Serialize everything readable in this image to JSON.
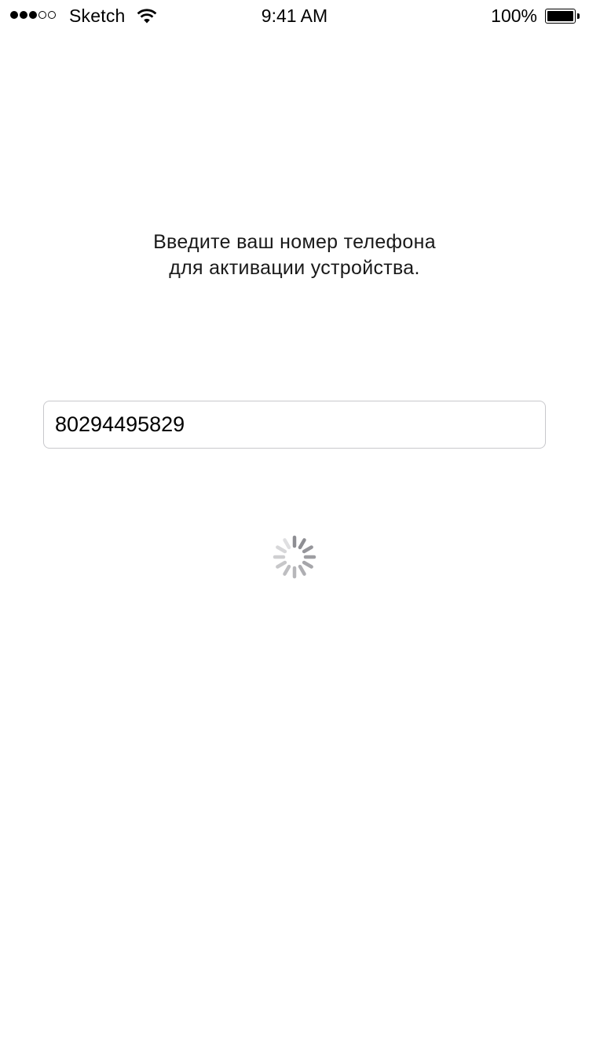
{
  "status_bar": {
    "signal_bars_filled": 3,
    "signal_bars_total": 5,
    "carrier": "Sketch",
    "time": "9:41 AM",
    "battery_percent": "100%",
    "icons": [
      "signal-dots-icon",
      "wifi-icon",
      "battery-icon"
    ]
  },
  "instruction": {
    "line1": "Введите ваш номер телефона",
    "line2": "для активации устройства."
  },
  "phone_input": {
    "value": "80294495829",
    "placeholder": ""
  },
  "loading": {
    "icon": "activity-spinner-icon",
    "active": true
  },
  "colors": {
    "background": "#ffffff",
    "text": "#000000",
    "field_border": "#c8c8cc",
    "spinner": "#8e8e93"
  }
}
